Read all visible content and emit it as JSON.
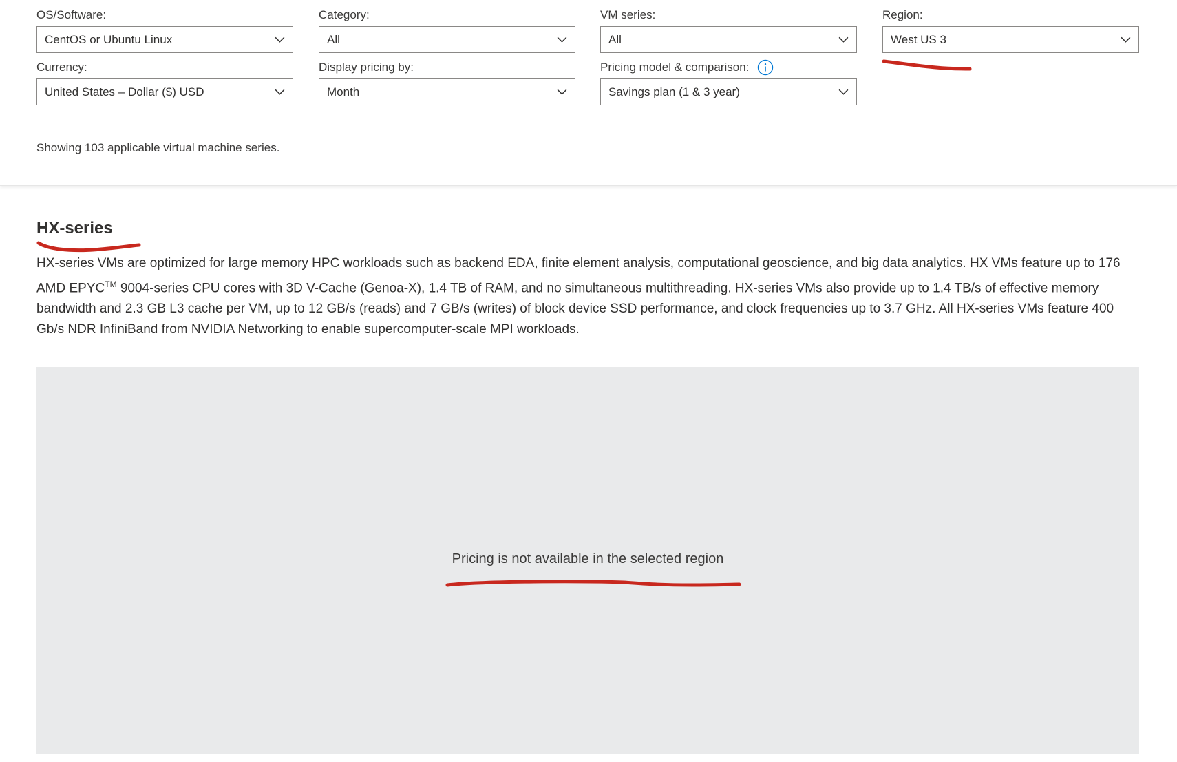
{
  "filters": {
    "os": {
      "label": "OS/Software:",
      "value": "CentOS or Ubuntu Linux"
    },
    "category": {
      "label": "Category:",
      "value": "All"
    },
    "vm_series": {
      "label": "VM series:",
      "value": "All"
    },
    "region": {
      "label": "Region:",
      "value": "West US 3"
    },
    "currency": {
      "label": "Currency:",
      "value": "United States – Dollar ($) USD"
    },
    "display_pricing": {
      "label": "Display pricing by:",
      "value": "Month"
    },
    "pricing_model": {
      "label": "Pricing model & comparison:",
      "value": "Savings plan (1 & 3 year)"
    }
  },
  "count_text": "Showing 103 applicable virtual machine series.",
  "series": {
    "title": "HX-series",
    "desc_part1": "HX-series VMs are optimized for large memory HPC workloads such as backend EDA, finite element analysis, computational geoscience, and big data analytics. HX VMs feature up to 176 AMD EPYC",
    "desc_tm": "TM",
    "desc_part2": " 9004-series CPU cores with 3D V-Cache (Genoa-X), 1.4 TB of RAM, and no simultaneous multithreading. HX-series VMs also provide up to 1.4 TB/s of effective memory bandwidth and 2.3 GB L3 cache per VM, up to 12 GB/s (reads) and 7 GB/s (writes) of block device SSD performance, and clock frequencies up to 3.7 GHz. All HX-series VMs feature 400 Gb/s NDR InfiniBand from NVIDIA Networking to enable supercomputer-scale MPI workloads."
  },
  "pricing_message": "Pricing is not available in the selected region",
  "icons": {
    "dropdown": "chevron-down-icon",
    "info": "info-icon"
  },
  "colors": {
    "annotation": "#c8281e",
    "info_blue": "#0078d4",
    "panel_bg": "#e9eaeb",
    "select_border": "#8a8886"
  }
}
